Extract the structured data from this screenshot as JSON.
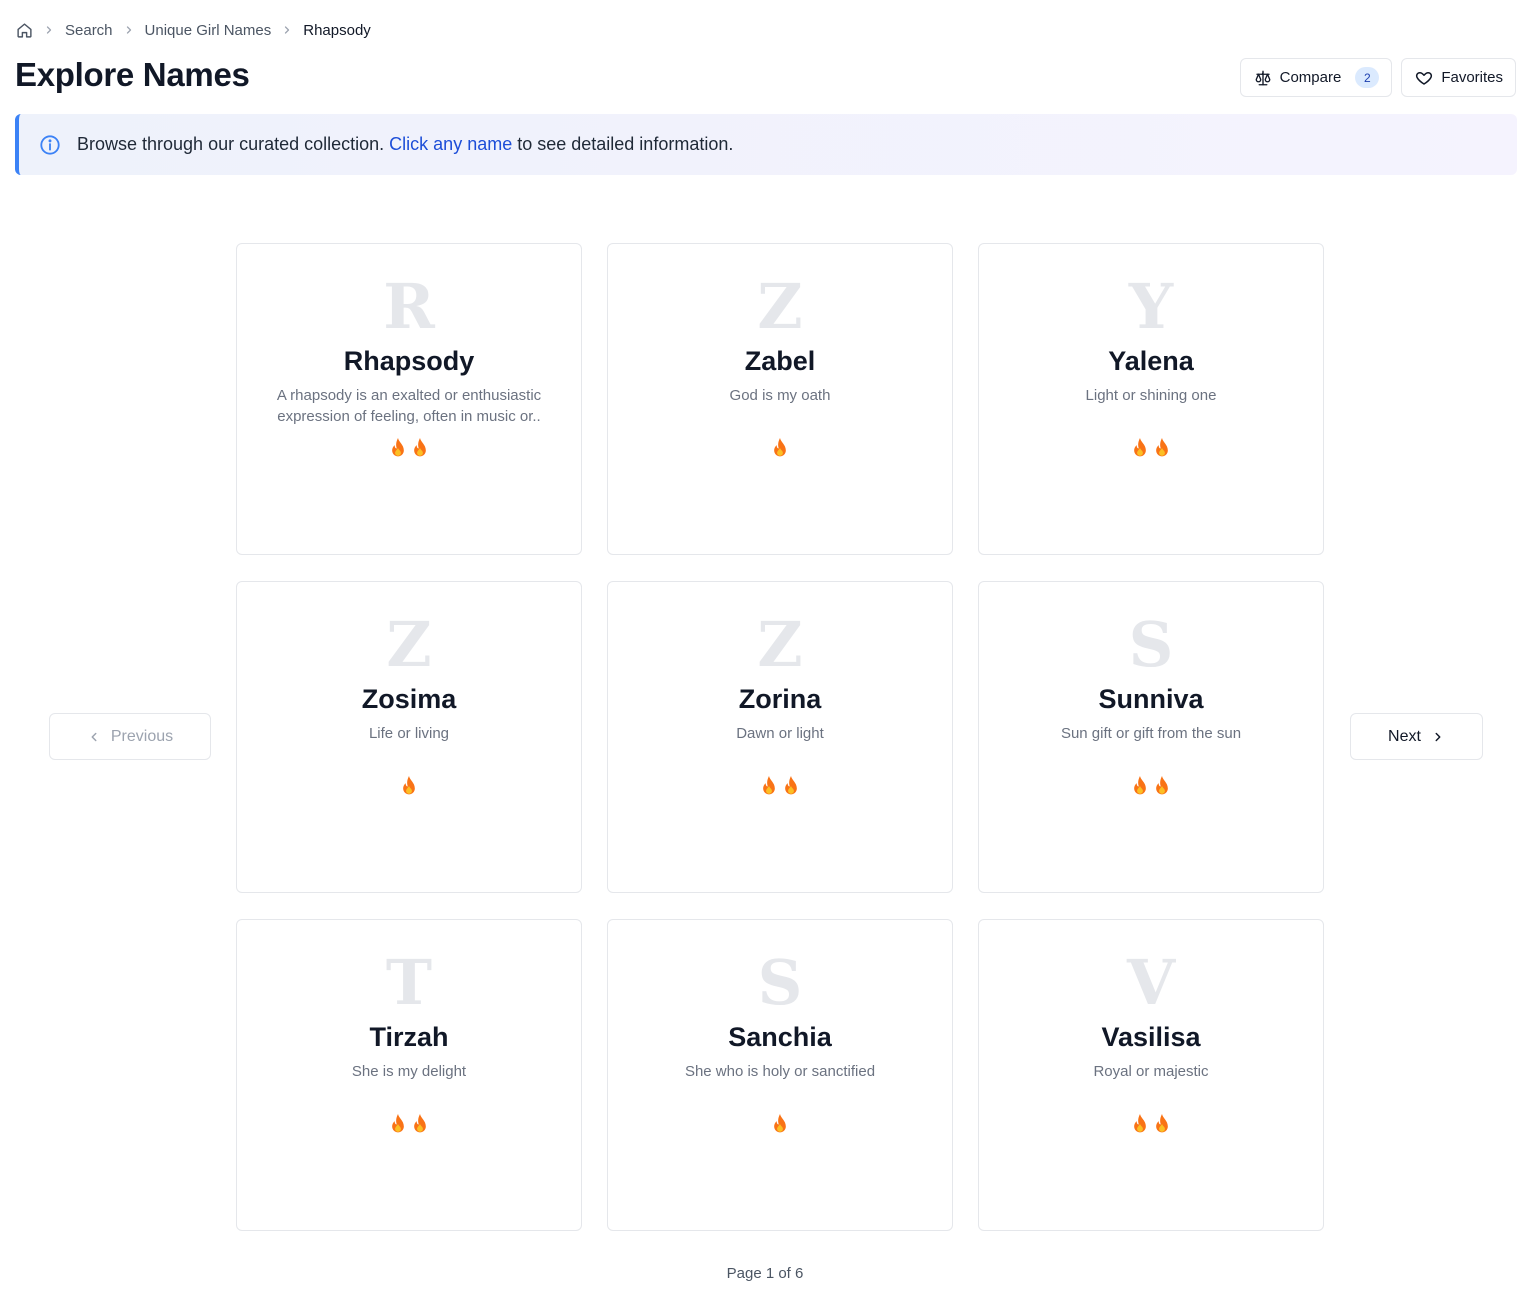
{
  "breadcrumb": {
    "items": [
      "Search",
      "Unique Girl Names"
    ],
    "current": "Rhapsody"
  },
  "page": {
    "title": "Explore Names"
  },
  "header": {
    "compare_label": "Compare",
    "compare_count": "2",
    "favorites_label": "Favorites"
  },
  "info": {
    "text_before": "Browse through our curated collection. ",
    "link_text": "Click any name",
    "text_after": " to see detailed information."
  },
  "cards": [
    {
      "letter": "R",
      "name": "Rhapsody",
      "meaning": "A rhapsody is an exalted or enthusiastic expression of feeling, often in music or..",
      "popularity": 2
    },
    {
      "letter": "Z",
      "name": "Zabel",
      "meaning": "God is my oath",
      "popularity": 1
    },
    {
      "letter": "Y",
      "name": "Yalena",
      "meaning": "Light or shining one",
      "popularity": 2
    },
    {
      "letter": "Z",
      "name": "Zosima",
      "meaning": "Life or living",
      "popularity": 1
    },
    {
      "letter": "Z",
      "name": "Zorina",
      "meaning": "Dawn or light",
      "popularity": 2
    },
    {
      "letter": "S",
      "name": "Sunniva",
      "meaning": "Sun gift or gift from the sun",
      "popularity": 2
    },
    {
      "letter": "T",
      "name": "Tirzah",
      "meaning": "She is my delight",
      "popularity": 2
    },
    {
      "letter": "S",
      "name": "Sanchia",
      "meaning": "She who is holy or sanctified",
      "popularity": 1
    },
    {
      "letter": "V",
      "name": "Vasilisa",
      "meaning": "Royal or majestic",
      "popularity": 2
    }
  ],
  "pagination": {
    "previous_label": "Previous",
    "next_label": "Next",
    "page_text": "Page 1 of 6"
  },
  "colors": {
    "accent": "#3b82f6",
    "link": "#1d4ed8",
    "badge_bg": "#dbeafe",
    "flame": "#f97316"
  }
}
